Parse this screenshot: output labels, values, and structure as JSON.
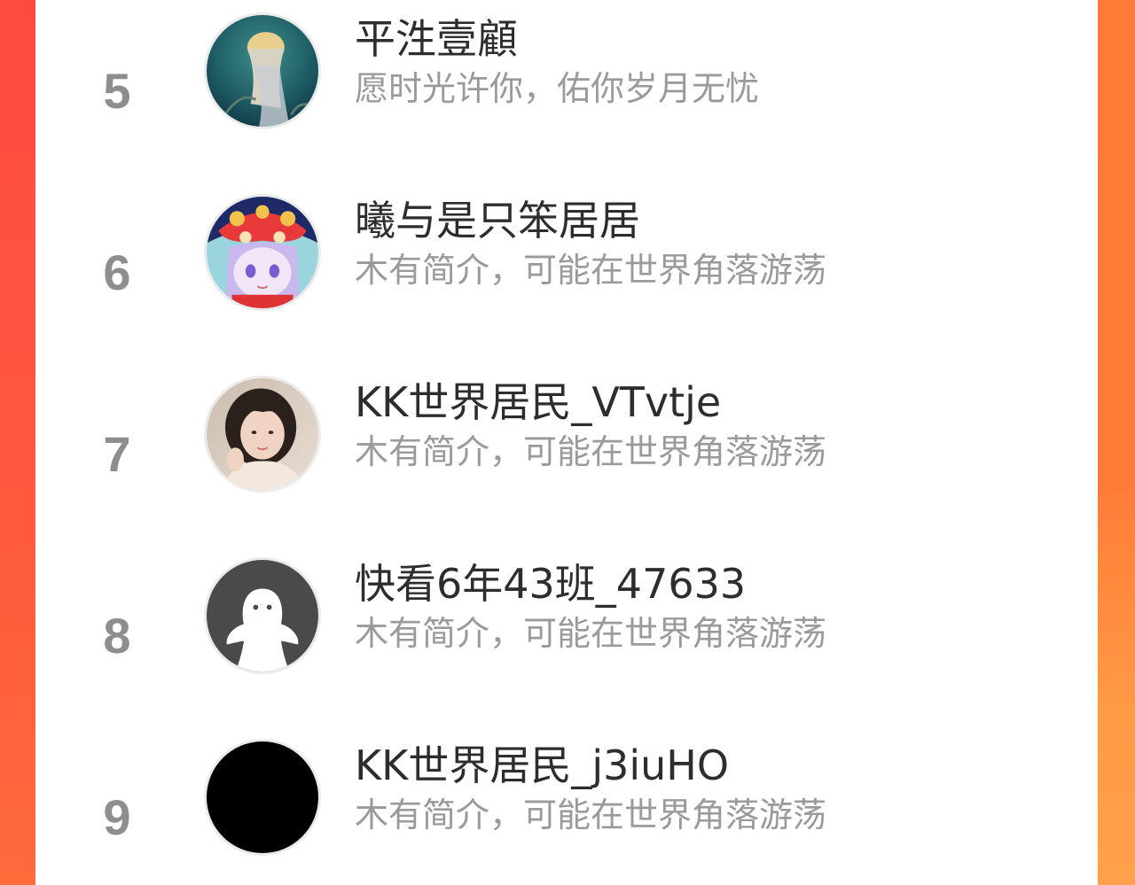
{
  "rankings": [
    {
      "rank": "5",
      "name": "平泩壹顧",
      "bio": "愿时光许你，佑你岁月无忧",
      "avatar_icon": "anime-girl-teal-avatar"
    },
    {
      "rank": "6",
      "name": "曦与是只笨居居",
      "bio": "木有简介，可能在世界角落游荡",
      "avatar_icon": "anime-lion-dance-avatar"
    },
    {
      "rank": "7",
      "name": "KK世界居民_VTvtje",
      "bio": "木有简介，可能在世界角落游荡",
      "avatar_icon": "photo-girl-avatar"
    },
    {
      "rank": "8",
      "name": "快看6年43班_47633",
      "bio": "木有简介，可能在世界角落游荡",
      "avatar_icon": "default-ghost-avatar"
    },
    {
      "rank": "9",
      "name": "KK世界居民_j3iuHO",
      "bio": "木有简介，可能在世界角落游荡",
      "avatar_icon": "black-avatar"
    }
  ],
  "colors": {
    "background_left": "#ff4f3f",
    "background_right": "#ff9a40",
    "panel": "#ffffff",
    "rank_text": "#8e8e8e",
    "name_text": "#2d2d2d",
    "bio_text": "#9a9a9a"
  }
}
